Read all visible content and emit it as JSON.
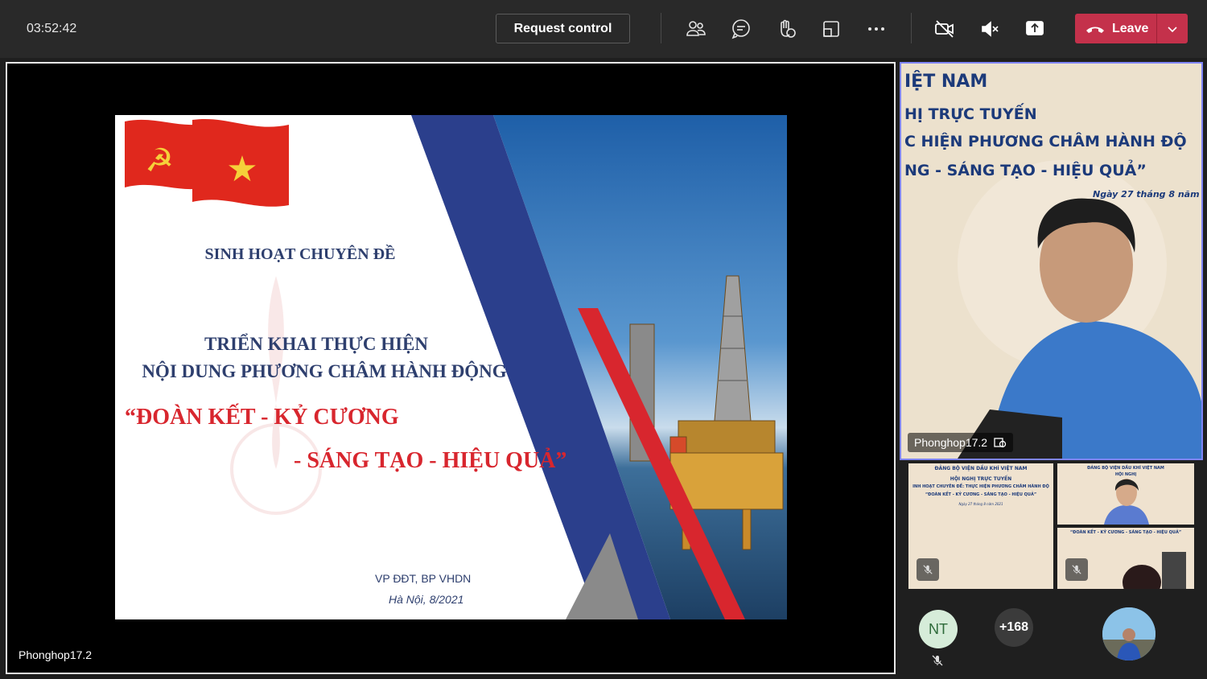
{
  "meeting": {
    "timer": "03:52:42",
    "request_control_label": "Request control",
    "leave_label": "Leave"
  },
  "toolbar_icons": [
    "people-icon",
    "chat-icon",
    "raise-hand-icon",
    "share-tray-icon",
    "more-icon",
    "camera-off-icon",
    "mic-muted-icon",
    "share-screen-icon"
  ],
  "stage": {
    "presenter_name": "Phonghop17.2",
    "slide": {
      "subtitle": "SINH HOẠT CHUYÊN ĐỀ",
      "line1": "TRIỂN KHAI THỰC HIỆN",
      "line2": "NỘI DUNG PHƯƠNG CHÂM HÀNH ĐỘNG",
      "motto1": "“ĐOÀN KẾT - KỶ CƯƠNG",
      "motto2": "- SÁNG TẠO - HIỆU QUẢ”",
      "org": "VP ĐĐT, BP VHDN",
      "date": "Hà Nội, 8/2021"
    }
  },
  "pinned": {
    "name": "Phonghop17.2",
    "banner_lines": [
      "IỆT NAM",
      "HỊ TRỰC TUYẾN",
      "C HIỆN PHƯƠNG CHÂM HÀNH ĐỘ",
      "NG - SÁNG TẠO - HIỆU QUẢ”",
      "Ngày 27 tháng 8 năm"
    ]
  },
  "tiles": {
    "t1_lines": [
      "ĐẢNG BỘ VIỆN DẦU KHÍ VIỆT NAM",
      "HỘI NGHỊ TRỰC TUYẾN",
      "INH HOẠT CHUYÊN ĐỀ: THỰC HIỆN PHƯƠNG CHÂM HÀNH ĐỘ",
      "“ĐOÀN KẾT - KỶ CƯƠNG - SÁNG TẠO - HIỆU QUẢ”",
      "Ngày 27 tháng 8 năm 2021"
    ],
    "t2_lines": [
      "ĐẢNG BỘ VIỆN DẦU KHÍ VIỆT NAM",
      "HỘI NGHỊ"
    ],
    "t3_lines": [
      "“ĐOÀN KẾT - KỶ CƯƠNG - SÁNG TẠO - HIỆU QUẢ”"
    ]
  },
  "participants": {
    "initials": "NT",
    "more_count": "+168"
  },
  "colors": {
    "accent": "#7f85f5",
    "leave": "#c4314b",
    "slide_navy": "#2e3f6e",
    "slide_red": "#d8262e"
  }
}
